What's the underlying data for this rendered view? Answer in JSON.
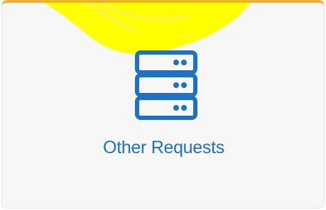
{
  "card": {
    "label": "Other Requests",
    "icon": "server-icon",
    "accent_color": "#1a73c9",
    "highlight_color": "#ffff00",
    "top_border_color": "#f0b429"
  }
}
